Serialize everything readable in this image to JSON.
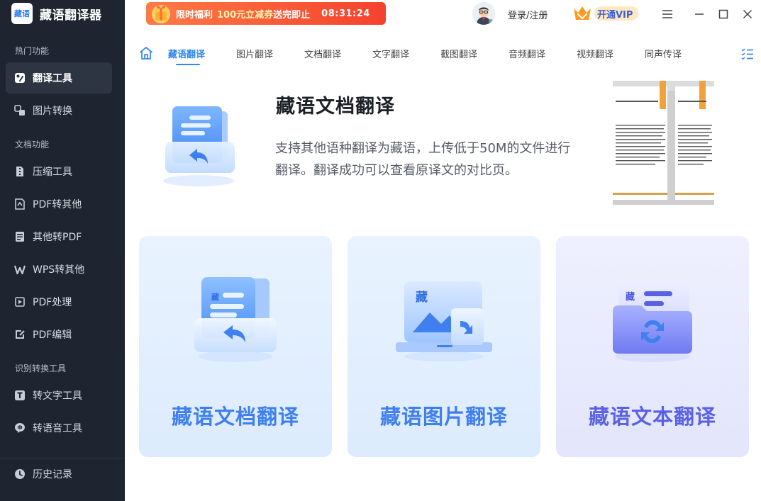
{
  "app": {
    "title": "藏语翻译器",
    "logo_text": "藏语"
  },
  "sidebar": {
    "sections": [
      {
        "label": "热门功能"
      },
      {
        "label": "文档功能"
      },
      {
        "label": "识别转换工具"
      }
    ],
    "items": [
      {
        "label": "翻译工具",
        "icon": "translate-icon"
      },
      {
        "label": "图片转换",
        "icon": "image-convert-icon"
      },
      {
        "label": "压缩工具",
        "icon": "compress-icon"
      },
      {
        "label": "PDF转其他",
        "icon": "pdf-export-icon"
      },
      {
        "label": "其他转PDF",
        "icon": "to-pdf-icon"
      },
      {
        "label": "WPS转其他",
        "icon": "wps-icon"
      },
      {
        "label": "PDF处理",
        "icon": "pdf-process-icon"
      },
      {
        "label": "PDF编辑",
        "icon": "pdf-edit-icon"
      },
      {
        "label": "转文字工具",
        "icon": "text-tool-icon"
      },
      {
        "label": "转语音工具",
        "icon": "voice-tool-icon"
      }
    ],
    "history_label": "历史记录"
  },
  "header": {
    "promo": {
      "part1": "限时福利",
      "amount": "100元立减券",
      "part2": "送完即止",
      "timer": "08:31:24"
    },
    "login_label": "登录/注册",
    "vip_label": "开通VIP"
  },
  "tabs": [
    {
      "label": "藏语翻译"
    },
    {
      "label": "图片翻译"
    },
    {
      "label": "文档翻译"
    },
    {
      "label": "文字翻译"
    },
    {
      "label": "截图翻译"
    },
    {
      "label": "音频翻译"
    },
    {
      "label": "视频翻译"
    },
    {
      "label": "同声传译"
    }
  ],
  "hero": {
    "title": "藏语文档翻译",
    "description": "支持其他语种翻译为藏语，上传低于50M的文件进行翻译。翻译成功可以查看原译文的对比页。"
  },
  "cards": [
    {
      "title": "藏语文档翻译",
      "icon_text": "藏"
    },
    {
      "title": "藏语图片翻译",
      "icon_text": "藏"
    },
    {
      "title": "藏语文本翻译",
      "icon_text": "藏"
    }
  ],
  "colors": {
    "sidebar_bg": "#1f2530",
    "accent_blue": "#2f86ee",
    "promo_red": "#f5412e",
    "card_purple": "#5a61e6"
  }
}
